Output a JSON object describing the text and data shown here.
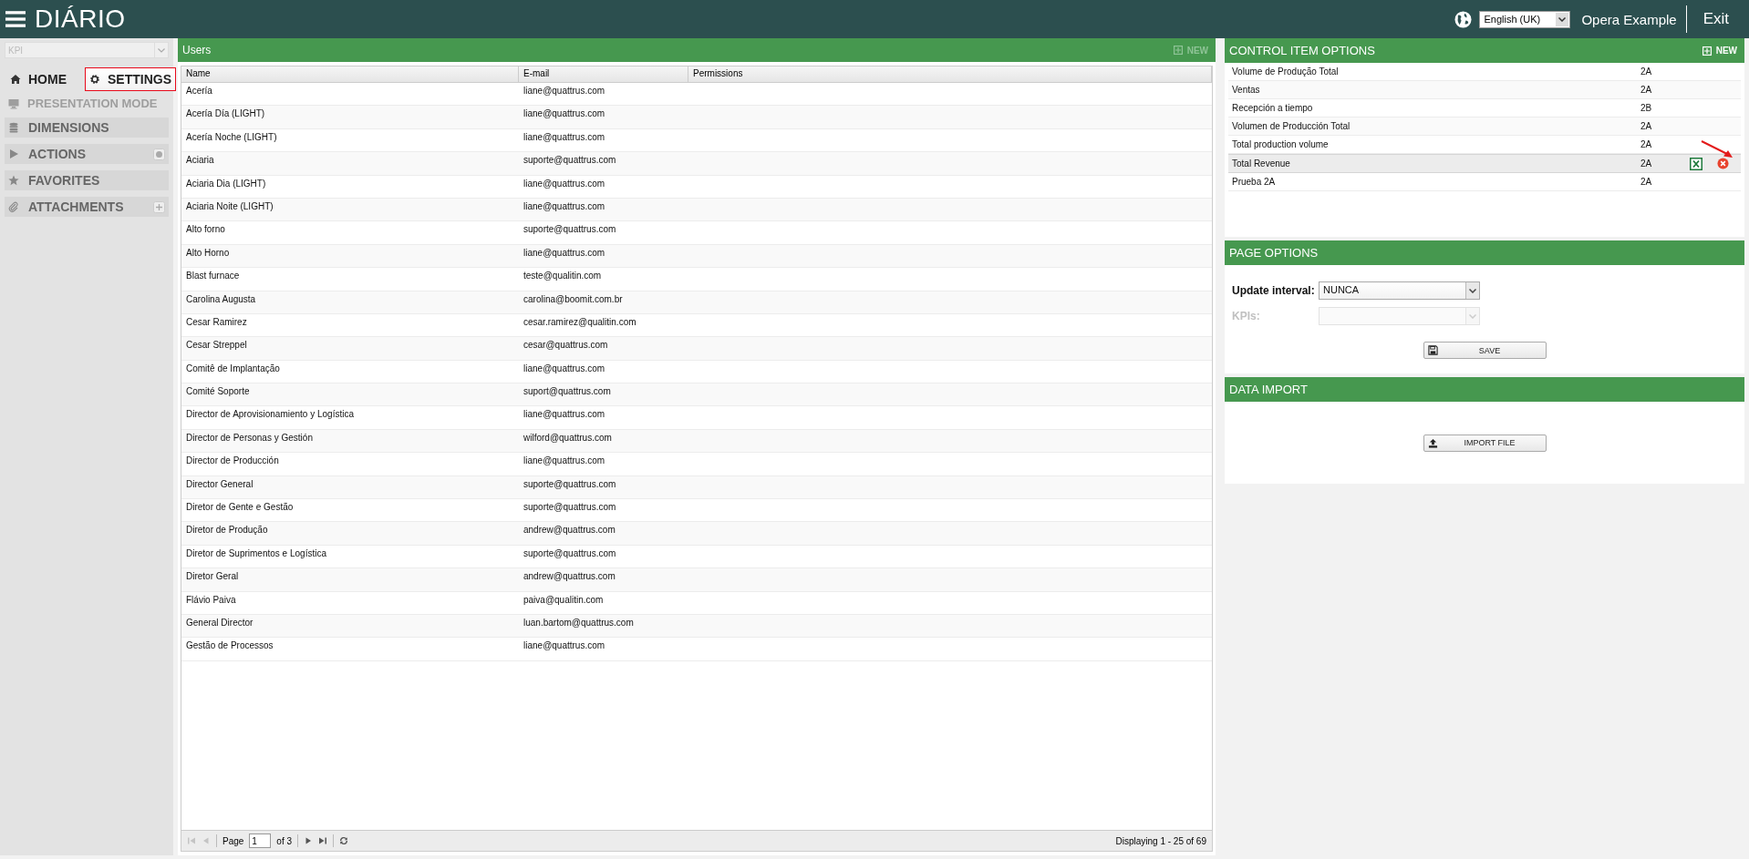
{
  "app": {
    "title": "DIÁRIO"
  },
  "header": {
    "language": "English (UK)",
    "user": "Opera Example",
    "exit": "Exit"
  },
  "sidebar": {
    "kpi_select": {
      "placeholder": "KPI"
    },
    "nav": [
      {
        "label": "HOME",
        "kind": "home",
        "selected": false
      },
      {
        "label": "SETTINGS",
        "kind": "gear",
        "selected": true
      }
    ],
    "presentation_mode": {
      "label": "PRESENTATION MODE",
      "disabled": true
    },
    "sections": [
      {
        "label": "DIMENSIONS",
        "kind": "database",
        "settings_button": false,
        "add_button": false
      },
      {
        "label": "ACTIONS",
        "kind": "play",
        "settings_button": true,
        "add_button": false
      },
      {
        "label": "FAVORITES",
        "kind": "star",
        "settings_button": false,
        "add_button": false
      },
      {
        "label": "ATTACHMENTS",
        "kind": "paperclip",
        "settings_button": false,
        "add_button": true
      }
    ]
  },
  "users": {
    "title": "Users",
    "new_button": {
      "label": "NEW",
      "disabled": true
    },
    "columns": [
      "Name",
      "E-mail",
      "Permissions"
    ],
    "rows": [
      {
        "name": "Acería",
        "email": "liane@quattrus.com"
      },
      {
        "name": "Acería Día (LIGHT)",
        "email": "liane@quattrus.com"
      },
      {
        "name": "Acería Noche (LIGHT)",
        "email": "liane@quattrus.com"
      },
      {
        "name": "Aciaria",
        "email": "suporte@quattrus.com"
      },
      {
        "name": "Aciaria Dia (LIGHT)",
        "email": "liane@quattrus.com"
      },
      {
        "name": "Aciaria Noite (LIGHT)",
        "email": "liane@quattrus.com"
      },
      {
        "name": "Alto forno",
        "email": "suporte@quattrus.com"
      },
      {
        "name": "Alto Horno",
        "email": "liane@quattrus.com"
      },
      {
        "name": "Blast furnace",
        "email": "teste@qualitin.com"
      },
      {
        "name": "Carolina Augusta",
        "email": "carolina@boomit.com.br"
      },
      {
        "name": "Cesar Ramirez",
        "email": "cesar.ramirez@qualitin.com"
      },
      {
        "name": "Cesar Streppel",
        "email": "cesar@quattrus.com"
      },
      {
        "name": "Comitê de Implantação",
        "email": "liane@quattrus.com"
      },
      {
        "name": "Comité Soporte",
        "email": "suport@quattrus.com"
      },
      {
        "name": "Director de Aprovisionamiento y Logística",
        "email": "liane@quattrus.com"
      },
      {
        "name": "Director de Personas y Gestión",
        "email": "wilford@quattrus.com"
      },
      {
        "name": "Director de Producción",
        "email": "liane@quattrus.com"
      },
      {
        "name": "Director General",
        "email": "suporte@quattrus.com"
      },
      {
        "name": "Diretor de Gente e Gestão",
        "email": "suporte@quattrus.com"
      },
      {
        "name": "Diretor de Produção",
        "email": "andrew@quattrus.com"
      },
      {
        "name": "Diretor de Suprimentos e Logística",
        "email": "suporte@quattrus.com"
      },
      {
        "name": "Diretor Geral",
        "email": "andrew@quattrus.com"
      },
      {
        "name": "Flávio Paiva",
        "email": "paiva@qualitin.com"
      },
      {
        "name": "General Director",
        "email": "luan.bartom@quattrus.com"
      },
      {
        "name": "Gestão de Processos",
        "email": "liane@quattrus.com"
      }
    ],
    "pager": {
      "page_label": "Page",
      "page": "1",
      "of": "of 3",
      "first_disabled": true,
      "last_disabled": false,
      "display": "Displaying 1 - 25 of 69"
    }
  },
  "control_items": {
    "title": "CONTROL ITEM OPTIONS",
    "new_button": {
      "label": "NEW",
      "disabled": false
    },
    "rows": [
      {
        "name": "Volume de Produção Total",
        "code": "2A",
        "selected": false
      },
      {
        "name": "Ventas",
        "code": "2A",
        "selected": false
      },
      {
        "name": "Recepción a tiempo",
        "code": "2B",
        "selected": false
      },
      {
        "name": "Volumen de Producción Total",
        "code": "2A",
        "selected": false
      },
      {
        "name": "Total production volume",
        "code": "2A",
        "selected": false
      },
      {
        "name": "Total Revenue",
        "code": "2A",
        "selected": true
      },
      {
        "name": "Prueba 2A",
        "code": "2A",
        "selected": false
      }
    ]
  },
  "page_options": {
    "title": "PAGE OPTIONS",
    "fields": [
      {
        "label": "Update interval:",
        "value": "NUNCA",
        "disabled": false
      },
      {
        "label": "KPIs:",
        "disabled": true
      }
    ],
    "save_button": "SAVE"
  },
  "data_import": {
    "title": "DATA IMPORT",
    "button": "IMPORT FILE"
  }
}
